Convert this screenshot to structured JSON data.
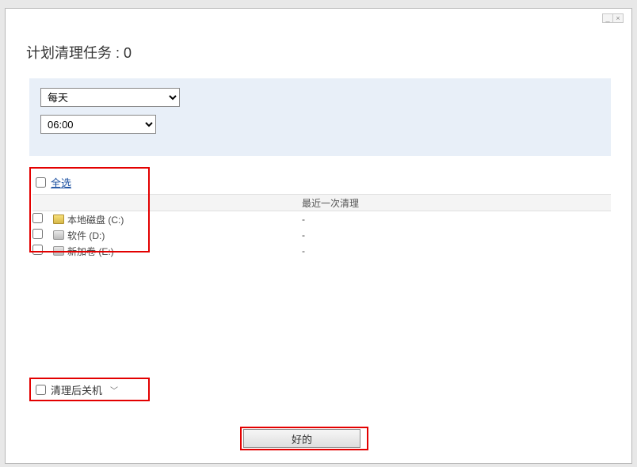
{
  "window": {
    "title": "计划清理任务 : 0",
    "minimize_label": "_",
    "close_label": "×"
  },
  "schedule": {
    "frequency": "每天",
    "time": "06:00"
  },
  "drives": {
    "select_all_label": "全选",
    "columns": {
      "name": "",
      "last_clean": "最近一次清理"
    },
    "items": [
      {
        "label": "本地磁盘 (C:)",
        "last": "-",
        "icon": "system"
      },
      {
        "label": "软件 (D:)",
        "last": "-",
        "icon": "disk"
      },
      {
        "label": "新加卷 (E:)",
        "last": "-",
        "icon": "disk"
      }
    ]
  },
  "shutdown": {
    "label": "清理后关机"
  },
  "buttons": {
    "ok": "好的"
  }
}
